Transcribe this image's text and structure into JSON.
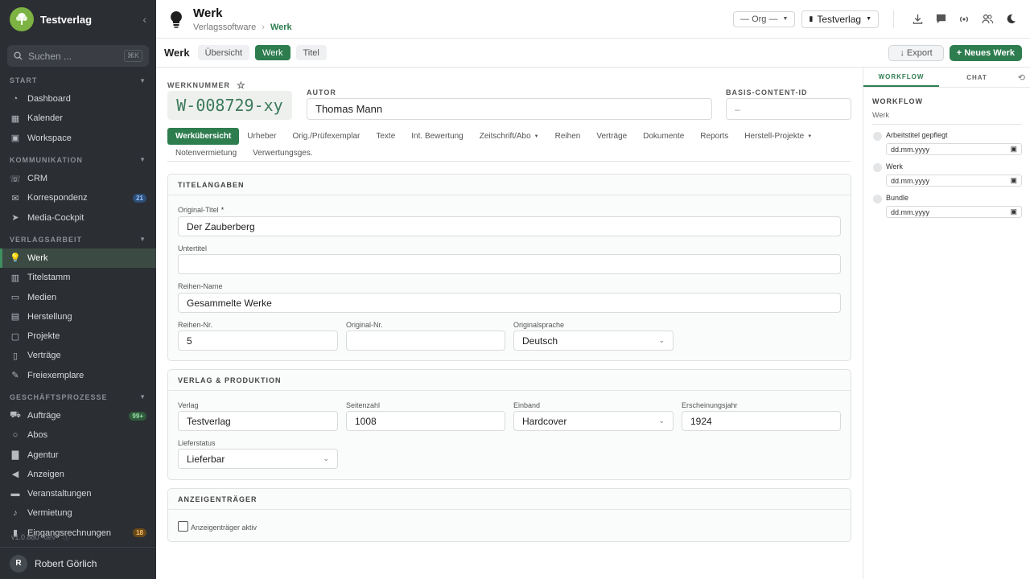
{
  "sidebar": {
    "brand": "Testverlag",
    "search_placeholder": "Suchen ...",
    "search_shortcut": "⌘K",
    "sections": [
      {
        "title": "START",
        "items": [
          {
            "label": "Dashboard",
            "icon": "dashboard-icon"
          },
          {
            "label": "Kalender",
            "icon": "calendar-icon"
          },
          {
            "label": "Workspace",
            "icon": "workspace-icon"
          }
        ]
      },
      {
        "title": "KOMMUNIKATION",
        "items": [
          {
            "label": "CRM",
            "icon": "crm-icon"
          },
          {
            "label": "Korrespondenz",
            "icon": "correspondence-icon",
            "badge": "21"
          },
          {
            "label": "Media-Cockpit",
            "icon": "media-cockpit-icon"
          }
        ]
      },
      {
        "title": "VERLAGSARBEIT",
        "items": [
          {
            "label": "Werk",
            "icon": "lightbulb-icon"
          },
          {
            "label": "Titelstamm",
            "icon": "title-master-icon"
          },
          {
            "label": "Medien",
            "icon": "media-icon"
          },
          {
            "label": "Herstellung",
            "icon": "production-icon"
          },
          {
            "label": "Projekte",
            "icon": "projects-icon"
          },
          {
            "label": "Verträge",
            "icon": "contracts-icon"
          },
          {
            "label": "Freiexemplare",
            "icon": "free-copies-icon"
          }
        ]
      },
      {
        "title": "GESCHÄFTSPROZESSE",
        "items": [
          {
            "label": "Aufträge",
            "icon": "orders-icon",
            "badge": "99+"
          },
          {
            "label": "Abos",
            "icon": "subscriptions-icon"
          },
          {
            "label": "Agentur",
            "icon": "agency-icon"
          },
          {
            "label": "Anzeigen",
            "icon": "ads-icon"
          },
          {
            "label": "Veranstaltungen",
            "icon": "events-icon"
          },
          {
            "label": "Vermietung",
            "icon": "rental-icon"
          },
          {
            "label": "Eingangsrechnungen",
            "icon": "invoices-icon",
            "badge": "18"
          }
        ]
      }
    ],
    "version": "v1.0.880",
    "env": "dev",
    "user_initial": "R",
    "user_name": "Robert Görlich"
  },
  "header": {
    "title": "Werk",
    "breadcrumb_parent": "Verlagssoftware",
    "breadcrumb_current": "Werk",
    "org_select": "— Org —",
    "tenant_select": "Testverlag"
  },
  "toolbar": {
    "title": "Werk",
    "tabs": [
      "Übersicht",
      "Werk",
      "Titel"
    ],
    "export_label": "↓ Export",
    "new_label": "+ Neues Werk"
  },
  "werk": {
    "werknummer_label": "WERKNUMMER",
    "werknummer": "W-008729-xy",
    "autor_label": "AUTOR",
    "autor": "Thomas Mann",
    "basis_label": "BASIS-CONTENT-ID",
    "basis_value": "–"
  },
  "subtabs": {
    "row1": [
      "Werkübersicht",
      "Urheber",
      "Orig./Prüfexemplar",
      "Texte",
      "Int. Bewertung",
      "Zeitschrift/Abo",
      "Reihen",
      "Verträge",
      "Dokumente",
      "Reports",
      "Herstell-Projekte"
    ],
    "row2": [
      "Notenvermietung",
      "Verwertungsges."
    ]
  },
  "titelangaben": {
    "header": "TITELANGABEN",
    "original_titel_label": "Original-Titel",
    "original_titel_required": "*",
    "original_titel": "Der Zauberberg",
    "untertitel_label": "Untertitel",
    "untertitel": "",
    "reihen_name_label": "Reihen-Name",
    "reihen_name": "Gesammelte Werke",
    "reihen_nr_label": "Reihen-Nr.",
    "reihen_nr": "5",
    "original_nr_label": "Original-Nr.",
    "original_nr": "",
    "originalsprache_label": "Originalsprache",
    "originalsprache": "Deutsch"
  },
  "verlag": {
    "header": "VERLAG & PRODUKTION",
    "verlag_label": "Verlag",
    "verlag": "Testverlag",
    "seitenzahl_label": "Seitenzahl",
    "seitenzahl": "1008",
    "einband_label": "Einband",
    "einband": "Hardcover",
    "jahr_label": "Erscheinungsjahr",
    "jahr": "1924",
    "lieferstatus_label": "Lieferstatus",
    "lieferstatus": "Lieferbar"
  },
  "anzeigen": {
    "header": "ANZEIGENTRÄGER",
    "checkbox_label": "Anzeigenträger aktiv"
  },
  "rpanel": {
    "tabs": [
      "WORKFLOW",
      "CHAT"
    ],
    "heading": "WORKFLOW",
    "sub": "Werk",
    "steps": [
      {
        "label": "Arbeitstitel gepflegt",
        "date": "dd.mm.yyyy"
      },
      {
        "label": "Werk",
        "date": "dd.mm.yyyy"
      },
      {
        "label": "Bundle",
        "date": "dd.mm.yyyy"
      }
    ]
  }
}
